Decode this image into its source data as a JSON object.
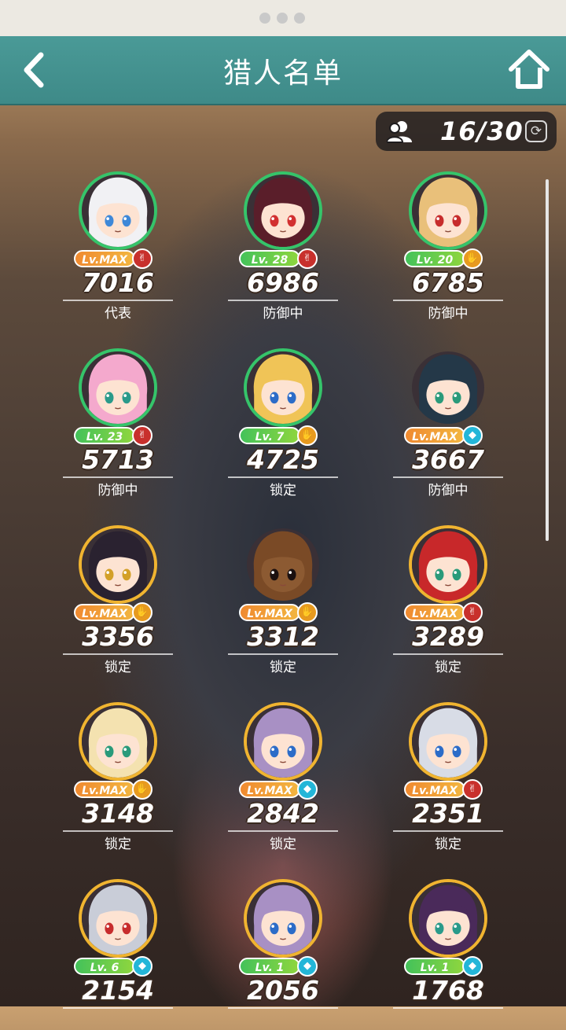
{
  "header": {
    "title": "猎人名单"
  },
  "counter": {
    "value": "16/30"
  },
  "hunters": [
    {
      "level": "Lv.MAX",
      "element": "red",
      "power": "7016",
      "status": "代表",
      "frame": "green",
      "hair": "#f1f1f4",
      "skin": "#fde3d2",
      "eye": "#3e88d8"
    },
    {
      "level": "Lv. 28",
      "element": "red",
      "power": "6986",
      "status": "防御中",
      "frame": "green",
      "hair": "#5a1e2a",
      "skin": "#fde3d2",
      "eye": "#d23030"
    },
    {
      "level": "Lv. 20",
      "element": "gold",
      "power": "6785",
      "status": "防御中",
      "frame": "green",
      "hair": "#e9c07a",
      "skin": "#fde3d2",
      "eye": "#c72c2c"
    },
    {
      "level": "Lv. 23",
      "element": "red",
      "power": "5713",
      "status": "防御中",
      "frame": "green",
      "hair": "#f4a9cd",
      "skin": "#fde3d2",
      "eye": "#2a9a8a"
    },
    {
      "level": "Lv. 7",
      "element": "gold",
      "power": "4725",
      "status": "锁定",
      "frame": "green",
      "hair": "#f0c457",
      "skin": "#fde3d2",
      "eye": "#2c6cc8"
    },
    {
      "level": "Lv.MAX",
      "element": "cyan",
      "power": "3667",
      "status": "防御中",
      "frame": "none",
      "hair": "#243848",
      "skin": "#fde3d2",
      "eye": "#2a9a7a"
    },
    {
      "level": "Lv.MAX",
      "element": "gold",
      "power": "3356",
      "status": "锁定",
      "frame": "gold",
      "hair": "#2a2230",
      "skin": "#fde3d2",
      "eye": "#d3a028"
    },
    {
      "level": "Lv.MAX",
      "element": "gold",
      "power": "3312",
      "status": "锁定",
      "frame": "none",
      "hair": "#7a4a26",
      "skin": "#8c5a32",
      "eye": "#1b1010"
    },
    {
      "level": "Lv.MAX",
      "element": "red",
      "power": "3289",
      "status": "锁定",
      "frame": "gold",
      "hair": "#c8282a",
      "skin": "#fde3d2",
      "eye": "#2a9a7a"
    },
    {
      "level": "Lv.MAX",
      "element": "gold",
      "power": "3148",
      "status": "锁定",
      "frame": "gold",
      "hair": "#f4e2b0",
      "skin": "#fde3d2",
      "eye": "#2a9a7a"
    },
    {
      "level": "Lv.MAX",
      "element": "cyan",
      "power": "2842",
      "status": "锁定",
      "frame": "gold",
      "hair": "#a890c4",
      "skin": "#fde3d2",
      "eye": "#2c6cc8"
    },
    {
      "level": "Lv.MAX",
      "element": "red",
      "power": "2351",
      "status": "锁定",
      "frame": "gold",
      "hair": "#d8dce6",
      "skin": "#fde3d2",
      "eye": "#2c6cc8"
    },
    {
      "level": "Lv. 6",
      "element": "cyan",
      "power": "2154",
      "status": "",
      "frame": "gold",
      "hair": "#c9cdd8",
      "skin": "#fde3d2",
      "eye": "#c72c2c"
    },
    {
      "level": "Lv. 1",
      "element": "cyan",
      "power": "2056",
      "status": "",
      "frame": "gold",
      "hair": "#a890c4",
      "skin": "#fde3d2",
      "eye": "#2c6cc8"
    },
    {
      "level": "Lv. 1",
      "element": "cyan",
      "power": "1768",
      "status": "",
      "frame": "gold",
      "hair": "#4a2a5a",
      "skin": "#fde3d2",
      "eye": "#2a9a8a"
    }
  ],
  "icons": {
    "back": "chevron-left-icon",
    "home": "home-icon",
    "people": "people-icon",
    "refresh": "refresh-icon",
    "element_red": "hand-peace-icon",
    "element_gold": "hand-open-icon",
    "element_cyan": "droplet-icon"
  }
}
